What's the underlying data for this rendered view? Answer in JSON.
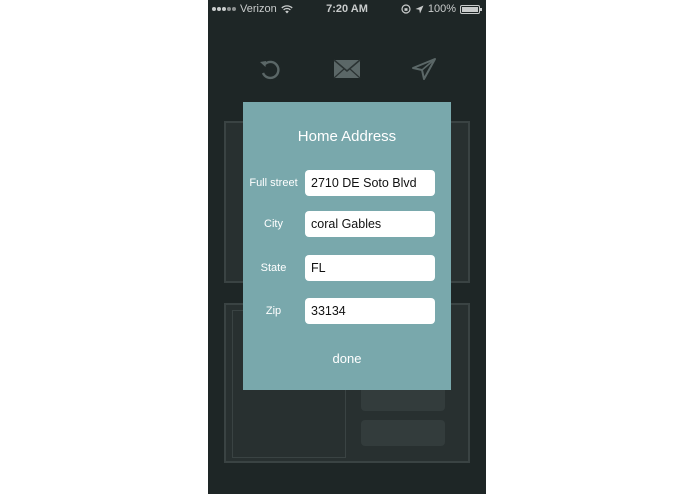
{
  "status_bar": {
    "carrier": "Verizon",
    "time": "7:20 AM",
    "battery": "100%"
  },
  "toolbar": {
    "icons": [
      "undo-icon",
      "envelope-icon",
      "send-icon"
    ]
  },
  "modal": {
    "title": "Home Address",
    "fields": {
      "street": {
        "label": "Full street",
        "value": "2710 DE Soto Blvd"
      },
      "city": {
        "label": "City",
        "value": "coral Gables"
      },
      "state": {
        "label": "State",
        "value": "FL"
      },
      "zip": {
        "label": "Zip",
        "value": "33134"
      }
    },
    "done_label": "done"
  },
  "colors": {
    "modal_background": "#79a8ac",
    "app_background": "#1e2626",
    "page_background": "#ffffff"
  }
}
